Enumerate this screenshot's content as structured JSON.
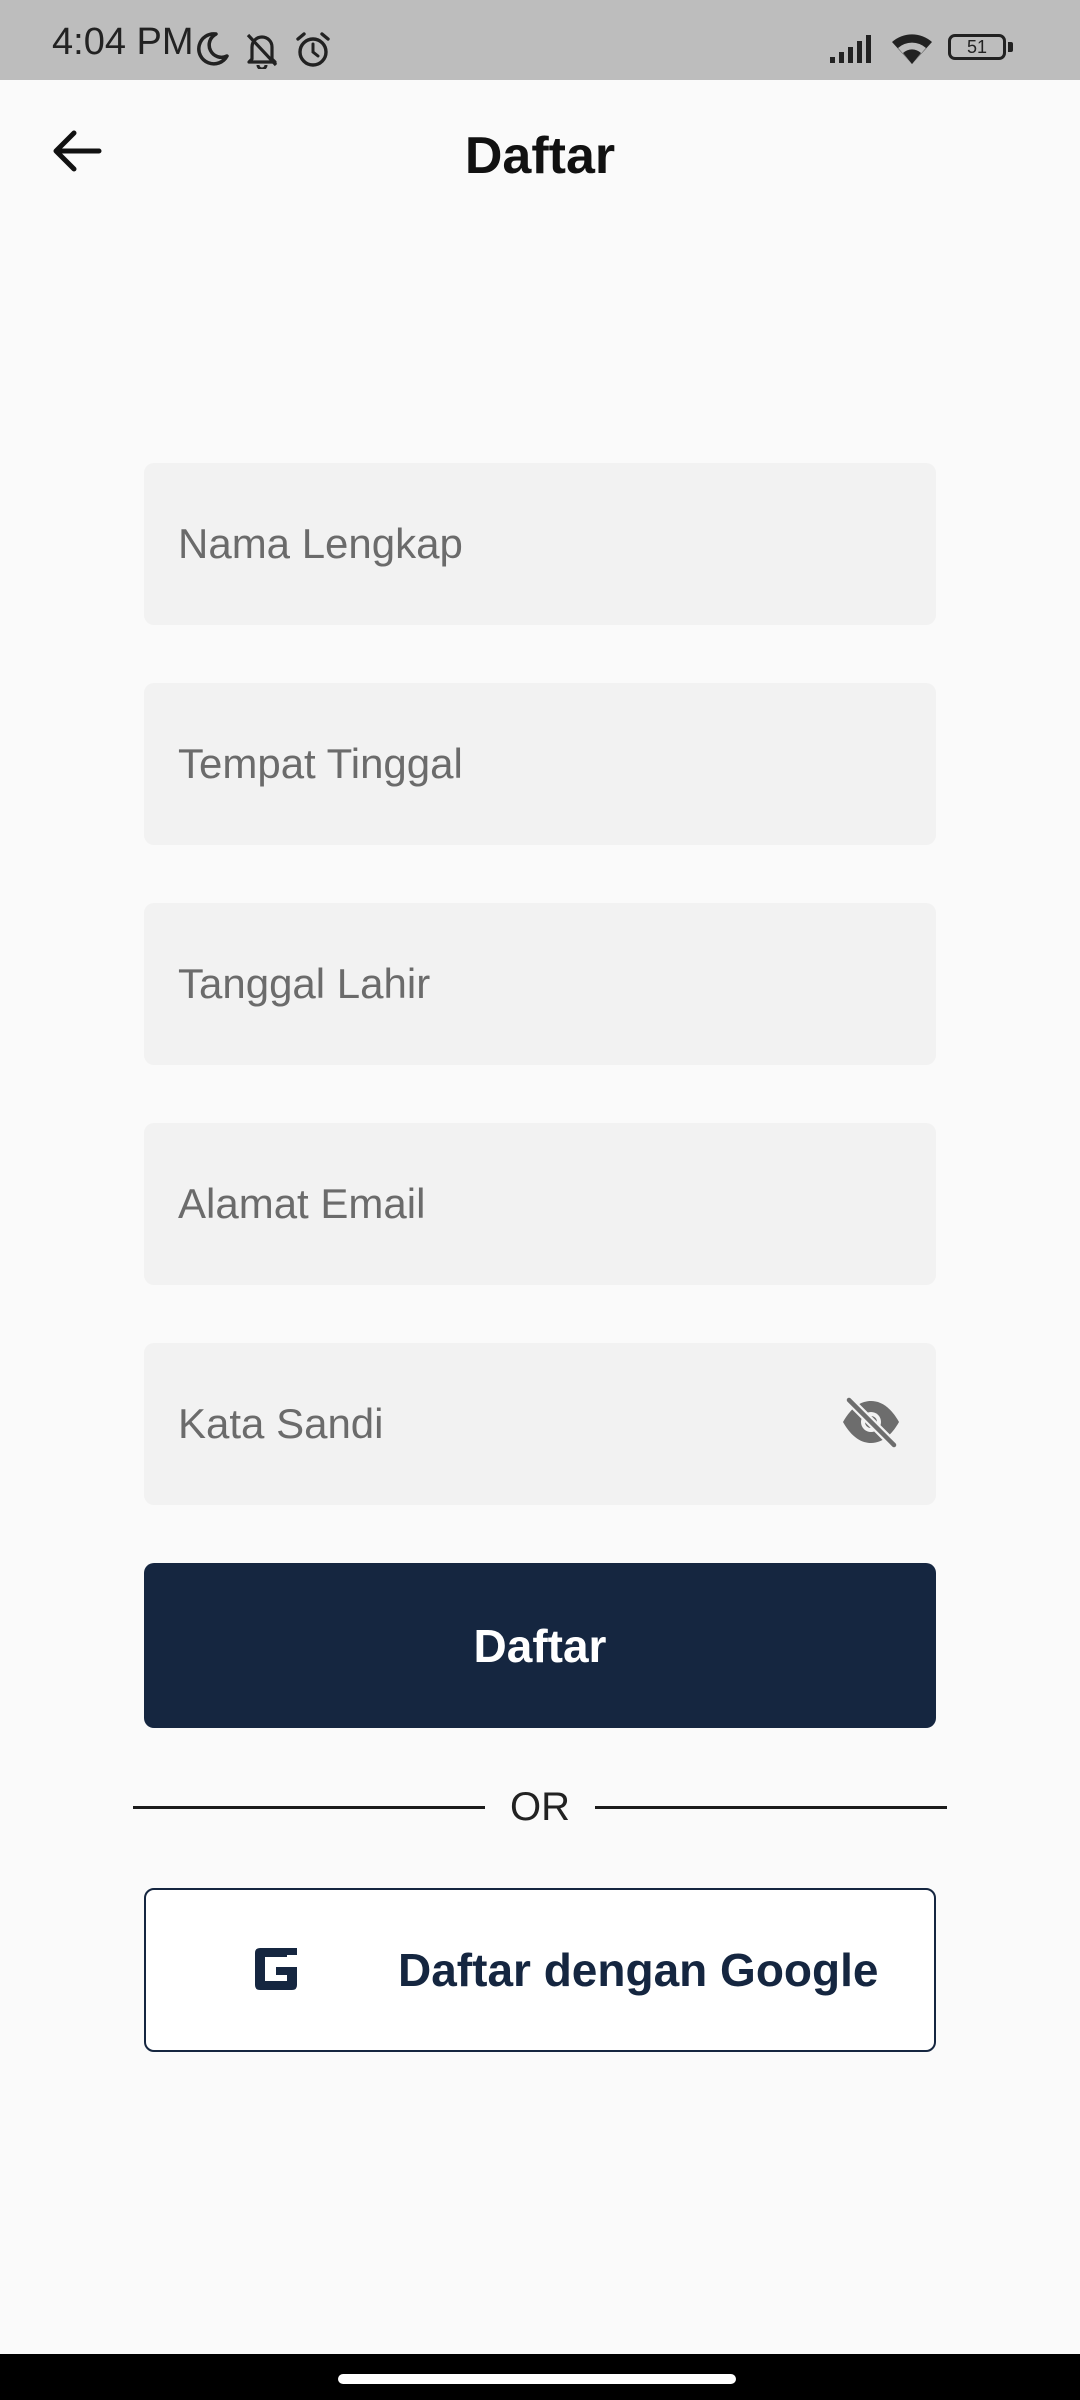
{
  "status_bar": {
    "time": "4:04 PM",
    "left_icons": [
      "moon-icon",
      "bell-off-icon",
      "alarm-icon"
    ],
    "right_icons": [
      "signal-icon",
      "wifi-icon",
      "battery-icon"
    ],
    "battery_level": "51"
  },
  "header": {
    "back_icon": "arrow-left-icon",
    "title": "Daftar"
  },
  "form": {
    "full_name": {
      "placeholder": "Nama Lengkap",
      "value": ""
    },
    "residence": {
      "placeholder": "Tempat Tinggal",
      "value": ""
    },
    "birth_date": {
      "placeholder": "Tanggal Lahir",
      "value": ""
    },
    "email": {
      "placeholder": "Alamat Email",
      "value": ""
    },
    "password": {
      "placeholder": "Kata Sandi",
      "value": "",
      "toggle_icon": "eye-off-icon"
    },
    "submit_label": "Daftar",
    "divider_label": "OR",
    "google_label": "Daftar dengan Google",
    "google_icon": "google-g-icon"
  },
  "colors": {
    "primary": "#152640",
    "background": "#fafafa",
    "field_background": "#f2f2f2",
    "status_bar": "#bdbdbd",
    "placeholder": "#6b6b6b"
  }
}
